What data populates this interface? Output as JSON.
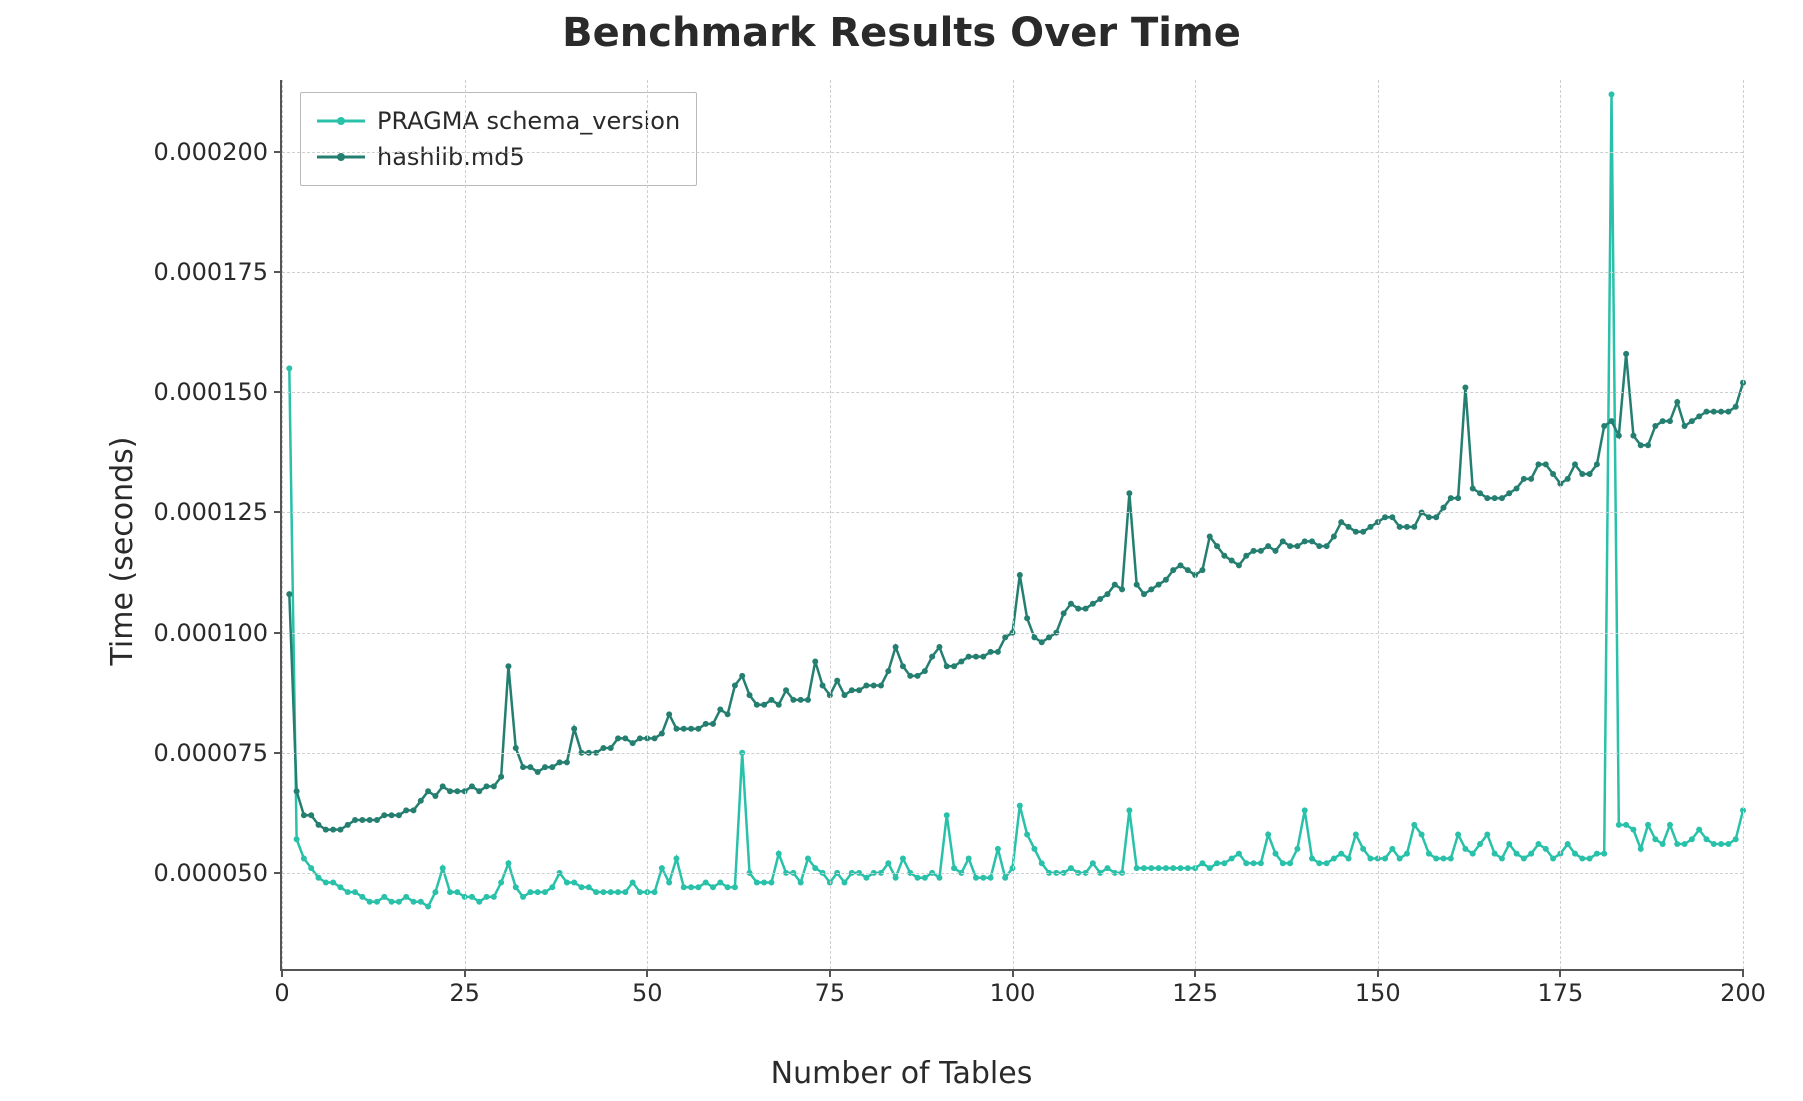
{
  "chart_data": {
    "type": "line",
    "title": "Benchmark Results Over Time",
    "xlabel": "Number of Tables",
    "ylabel": "Time (seconds)",
    "xlim": [
      0,
      200
    ],
    "ylim": [
      3e-05,
      0.000215
    ],
    "xticks": [
      0,
      25,
      50,
      75,
      100,
      125,
      150,
      175,
      200
    ],
    "yticks": [
      5e-05,
      7.5e-05,
      0.0001,
      0.000125,
      0.00015,
      0.000175,
      0.0002
    ],
    "ytick_labels": [
      "0.000050",
      "0.000075",
      "0.000100",
      "0.000125",
      "0.000150",
      "0.000175",
      "0.000200"
    ],
    "x": [
      1,
      2,
      3,
      4,
      5,
      6,
      7,
      8,
      9,
      10,
      11,
      12,
      13,
      14,
      15,
      16,
      17,
      18,
      19,
      20,
      21,
      22,
      23,
      24,
      25,
      26,
      27,
      28,
      29,
      30,
      31,
      32,
      33,
      34,
      35,
      36,
      37,
      38,
      39,
      40,
      41,
      42,
      43,
      44,
      45,
      46,
      47,
      48,
      49,
      50,
      51,
      52,
      53,
      54,
      55,
      56,
      57,
      58,
      59,
      60,
      61,
      62,
      63,
      64,
      65,
      66,
      67,
      68,
      69,
      70,
      71,
      72,
      73,
      74,
      75,
      76,
      77,
      78,
      79,
      80,
      81,
      82,
      83,
      84,
      85,
      86,
      87,
      88,
      89,
      90,
      91,
      92,
      93,
      94,
      95,
      96,
      97,
      98,
      99,
      100,
      101,
      102,
      103,
      104,
      105,
      106,
      107,
      108,
      109,
      110,
      111,
      112,
      113,
      114,
      115,
      116,
      117,
      118,
      119,
      120,
      121,
      122,
      123,
      124,
      125,
      126,
      127,
      128,
      129,
      130,
      131,
      132,
      133,
      134,
      135,
      136,
      137,
      138,
      139,
      140,
      141,
      142,
      143,
      144,
      145,
      146,
      147,
      148,
      149,
      150,
      151,
      152,
      153,
      154,
      155,
      156,
      157,
      158,
      159,
      160,
      161,
      162,
      163,
      164,
      165,
      166,
      167,
      168,
      169,
      170,
      171,
      172,
      173,
      174,
      175,
      176,
      177,
      178,
      179,
      180,
      181,
      182,
      183,
      184,
      185,
      186,
      187,
      188,
      189,
      190,
      191,
      192,
      193,
      194,
      195,
      196,
      197,
      198,
      199,
      200
    ],
    "series": [
      {
        "name": "PRAGMA schema_version",
        "color": "#29c1a9",
        "values": [
          0.000155,
          5.7e-05,
          5.3e-05,
          5.1e-05,
          4.9e-05,
          4.8e-05,
          4.8e-05,
          4.7e-05,
          4.6e-05,
          4.6e-05,
          4.5e-05,
          4.4e-05,
          4.4e-05,
          4.5e-05,
          4.4e-05,
          4.4e-05,
          4.5e-05,
          4.4e-05,
          4.4e-05,
          4.3e-05,
          4.6e-05,
          5.1e-05,
          4.6e-05,
          4.6e-05,
          4.5e-05,
          4.5e-05,
          4.4e-05,
          4.5e-05,
          4.5e-05,
          4.8e-05,
          5.2e-05,
          4.7e-05,
          4.5e-05,
          4.6e-05,
          4.6e-05,
          4.6e-05,
          4.7e-05,
          5e-05,
          4.8e-05,
          4.8e-05,
          4.7e-05,
          4.7e-05,
          4.6e-05,
          4.6e-05,
          4.6e-05,
          4.6e-05,
          4.6e-05,
          4.8e-05,
          4.6e-05,
          4.6e-05,
          4.6e-05,
          5.1e-05,
          4.8e-05,
          5.3e-05,
          4.7e-05,
          4.7e-05,
          4.7e-05,
          4.8e-05,
          4.7e-05,
          4.8e-05,
          4.7e-05,
          4.7e-05,
          7.5e-05,
          5e-05,
          4.8e-05,
          4.8e-05,
          4.8e-05,
          5.4e-05,
          5e-05,
          5e-05,
          4.8e-05,
          5.3e-05,
          5.1e-05,
          5e-05,
          4.8e-05,
          5e-05,
          4.8e-05,
          5e-05,
          5e-05,
          4.9e-05,
          5e-05,
          5e-05,
          5.2e-05,
          4.9e-05,
          5.3e-05,
          5e-05,
          4.9e-05,
          4.9e-05,
          5e-05,
          4.9e-05,
          6.2e-05,
          5.1e-05,
          5e-05,
          5.3e-05,
          4.9e-05,
          4.9e-05,
          4.9e-05,
          5.5e-05,
          4.9e-05,
          5.1e-05,
          6.4e-05,
          5.8e-05,
          5.5e-05,
          5.2e-05,
          5e-05,
          5e-05,
          5e-05,
          5.1e-05,
          5e-05,
          5e-05,
          5.2e-05,
          5e-05,
          5.1e-05,
          5e-05,
          5e-05,
          6.3e-05,
          5.1e-05,
          5.1e-05,
          5.1e-05,
          5.1e-05,
          5.1e-05,
          5.1e-05,
          5.1e-05,
          5.1e-05,
          5.1e-05,
          5.2e-05,
          5.1e-05,
          5.2e-05,
          5.2e-05,
          5.3e-05,
          5.4e-05,
          5.2e-05,
          5.2e-05,
          5.2e-05,
          5.8e-05,
          5.4e-05,
          5.2e-05,
          5.2e-05,
          5.5e-05,
          6.3e-05,
          5.3e-05,
          5.2e-05,
          5.2e-05,
          5.3e-05,
          5.4e-05,
          5.3e-05,
          5.8e-05,
          5.5e-05,
          5.3e-05,
          5.3e-05,
          5.3e-05,
          5.5e-05,
          5.3e-05,
          5.4e-05,
          6e-05,
          5.8e-05,
          5.4e-05,
          5.3e-05,
          5.3e-05,
          5.3e-05,
          5.8e-05,
          5.5e-05,
          5.4e-05,
          5.6e-05,
          5.8e-05,
          5.4e-05,
          5.3e-05,
          5.6e-05,
          5.4e-05,
          5.3e-05,
          5.4e-05,
          5.6e-05,
          5.5e-05,
          5.3e-05,
          5.4e-05,
          5.6e-05,
          5.4e-05,
          5.3e-05,
          5.3e-05,
          5.4e-05,
          5.4e-05,
          0.000212,
          6e-05,
          6e-05,
          5.9e-05,
          5.5e-05,
          6e-05,
          5.7e-05,
          5.6e-05,
          6e-05,
          5.6e-05,
          5.6e-05,
          5.7e-05,
          5.9e-05,
          5.7e-05,
          5.6e-05,
          5.6e-05,
          5.6e-05,
          5.7e-05,
          6.3e-05
        ]
      },
      {
        "name": "hashlib.md5",
        "color": "#257f71",
        "values": [
          0.000108,
          6.7e-05,
          6.2e-05,
          6.2e-05,
          6e-05,
          5.9e-05,
          5.9e-05,
          5.9e-05,
          6e-05,
          6.1e-05,
          6.1e-05,
          6.1e-05,
          6.1e-05,
          6.2e-05,
          6.2e-05,
          6.2e-05,
          6.3e-05,
          6.3e-05,
          6.5e-05,
          6.7e-05,
          6.6e-05,
          6.8e-05,
          6.7e-05,
          6.7e-05,
          6.7e-05,
          6.8e-05,
          6.7e-05,
          6.8e-05,
          6.8e-05,
          7e-05,
          9.3e-05,
          7.6e-05,
          7.2e-05,
          7.2e-05,
          7.1e-05,
          7.2e-05,
          7.2e-05,
          7.3e-05,
          7.3e-05,
          8e-05,
          7.5e-05,
          7.5e-05,
          7.5e-05,
          7.6e-05,
          7.6e-05,
          7.8e-05,
          7.8e-05,
          7.7e-05,
          7.8e-05,
          7.8e-05,
          7.8e-05,
          7.9e-05,
          8.3e-05,
          8e-05,
          8e-05,
          8e-05,
          8e-05,
          8.1e-05,
          8.1e-05,
          8.4e-05,
          8.3e-05,
          8.9e-05,
          9.1e-05,
          8.7e-05,
          8.5e-05,
          8.5e-05,
          8.6e-05,
          8.5e-05,
          8.8e-05,
          8.6e-05,
          8.6e-05,
          8.6e-05,
          9.4e-05,
          8.9e-05,
          8.7e-05,
          9e-05,
          8.7e-05,
          8.8e-05,
          8.8e-05,
          8.9e-05,
          8.9e-05,
          8.9e-05,
          9.2e-05,
          9.7e-05,
          9.3e-05,
          9.1e-05,
          9.1e-05,
          9.2e-05,
          9.5e-05,
          9.7e-05,
          9.3e-05,
          9.3e-05,
          9.4e-05,
          9.5e-05,
          9.5e-05,
          9.5e-05,
          9.6e-05,
          9.6e-05,
          9.9e-05,
          0.0001,
          0.000112,
          0.000103,
          9.9e-05,
          9.8e-05,
          9.9e-05,
          0.0001,
          0.000104,
          0.000106,
          0.000105,
          0.000105,
          0.000106,
          0.000107,
          0.000108,
          0.00011,
          0.000109,
          0.000129,
          0.00011,
          0.000108,
          0.000109,
          0.00011,
          0.000111,
          0.000113,
          0.000114,
          0.000113,
          0.000112,
          0.000113,
          0.00012,
          0.000118,
          0.000116,
          0.000115,
          0.000114,
          0.000116,
          0.000117,
          0.000117,
          0.000118,
          0.000117,
          0.000119,
          0.000118,
          0.000118,
          0.000119,
          0.000119,
          0.000118,
          0.000118,
          0.00012,
          0.000123,
          0.000122,
          0.000121,
          0.000121,
          0.000122,
          0.000123,
          0.000124,
          0.000124,
          0.000122,
          0.000122,
          0.000122,
          0.000125,
          0.000124,
          0.000124,
          0.000126,
          0.000128,
          0.000128,
          0.000151,
          0.00013,
          0.000129,
          0.000128,
          0.000128,
          0.000128,
          0.000129,
          0.00013,
          0.000132,
          0.000132,
          0.000135,
          0.000135,
          0.000133,
          0.000131,
          0.000132,
          0.000135,
          0.000133,
          0.000133,
          0.000135,
          0.000143,
          0.000144,
          0.000141,
          0.000158,
          0.000141,
          0.000139,
          0.000139,
          0.000143,
          0.000144,
          0.000144,
          0.000148,
          0.000143,
          0.000144,
          0.000145,
          0.000146,
          0.000146,
          0.000146,
          0.000146,
          0.000147,
          0.000152
        ]
      }
    ],
    "legend_position": "upper-left",
    "grid": true
  }
}
